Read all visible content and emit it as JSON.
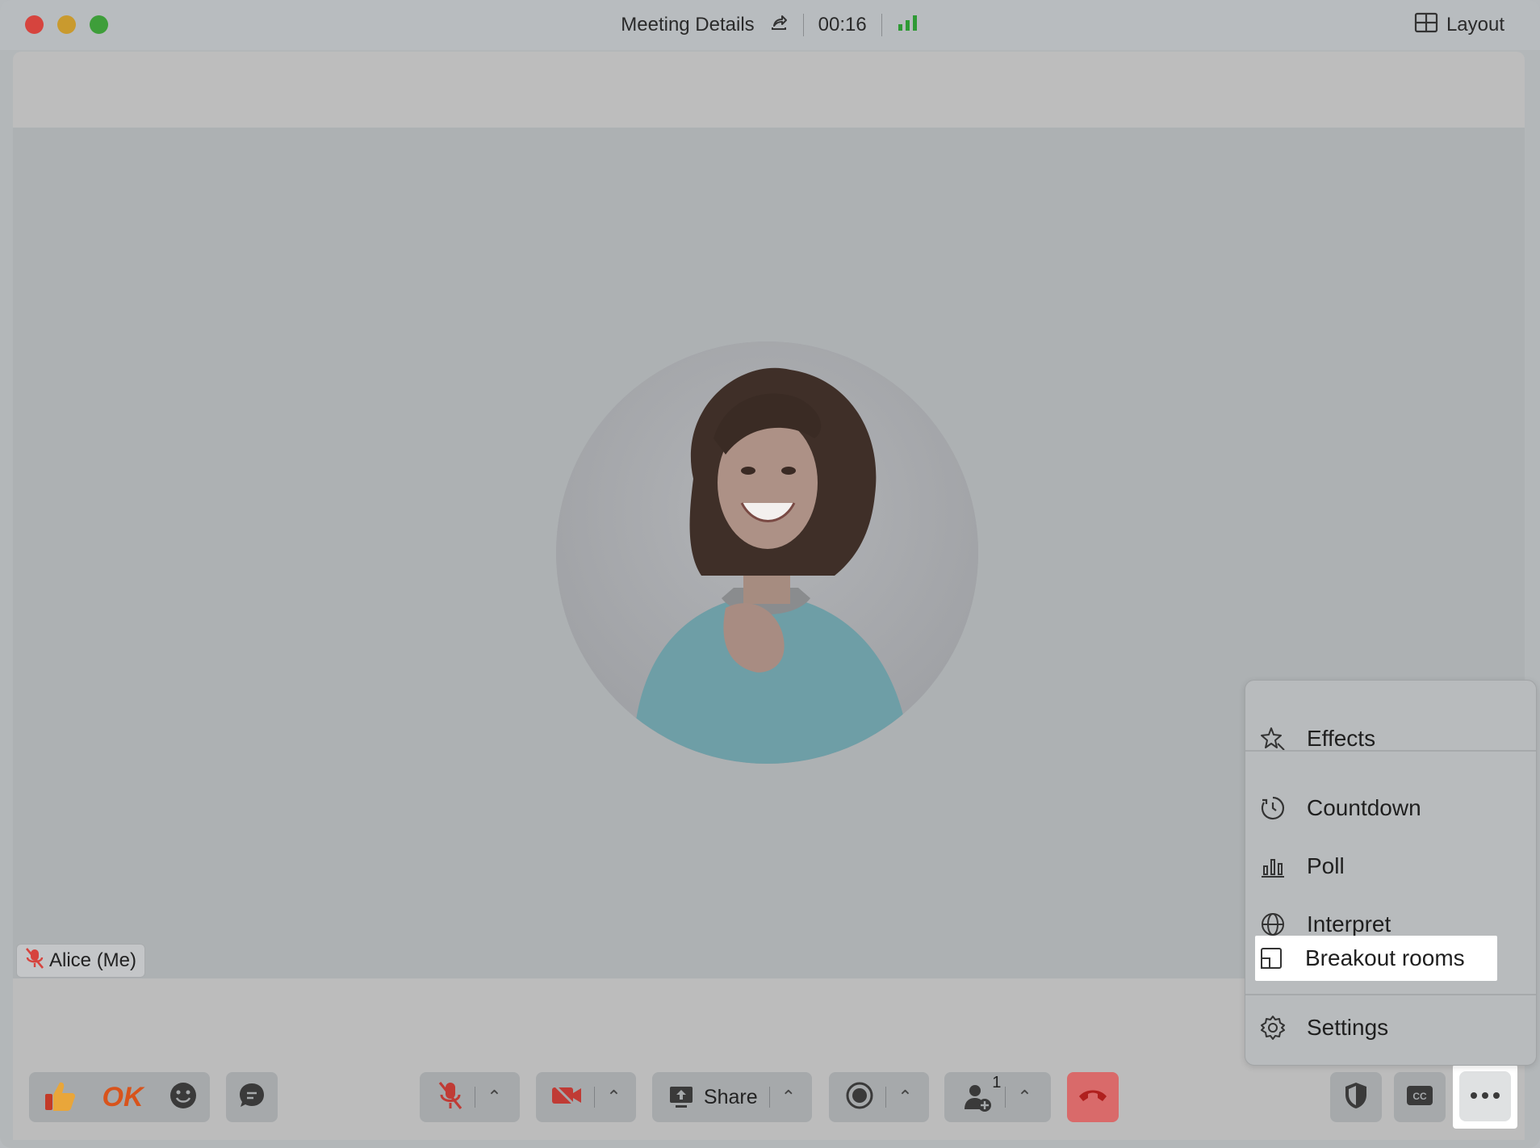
{
  "titlebar": {
    "meeting_details": "Meeting Details",
    "timer": "00:16",
    "layout_label": "Layout"
  },
  "participant": {
    "name": "Alice (Me)"
  },
  "toolbar": {
    "ok_label": "OK",
    "share_label": "Share",
    "participants_count": "1"
  },
  "menu": {
    "items": [
      {
        "label": "Effects",
        "icon": "sparkle-icon"
      },
      {
        "label": "Countdown",
        "icon": "timer-icon"
      },
      {
        "label": "Poll",
        "icon": "bar-chart-icon"
      },
      {
        "label": "Interpret",
        "icon": "globe-icon"
      },
      {
        "label": "Breakout rooms",
        "icon": "breakout-rooms-icon"
      },
      {
        "label": "Settings",
        "icon": "gear-icon"
      }
    ]
  },
  "colors": {
    "accent_red": "#d6443e",
    "signal_green": "#2f9a35",
    "hangup": "#d96a6a"
  }
}
